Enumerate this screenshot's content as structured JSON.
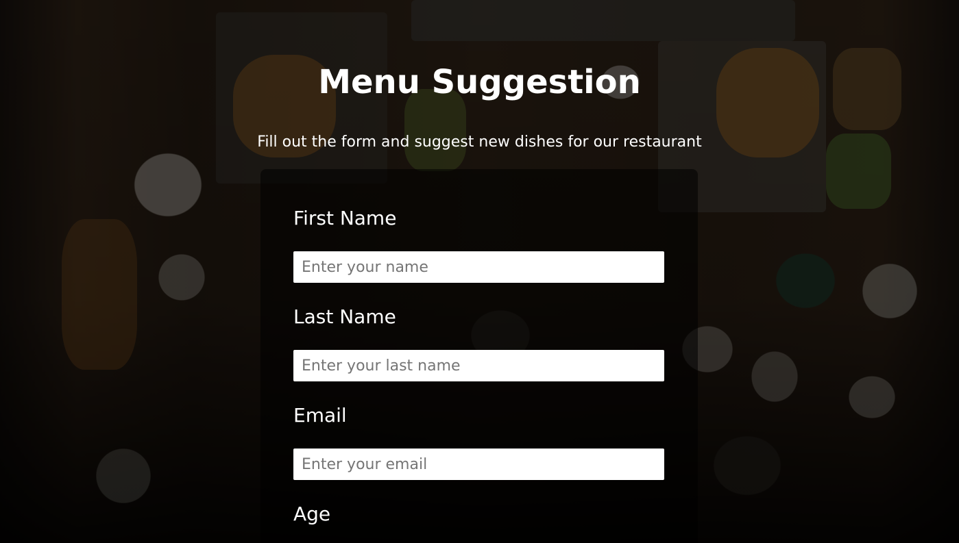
{
  "header": {
    "title": "Menu Suggestion",
    "subtitle": "Fill out the form and suggest new dishes for our restaurant"
  },
  "form": {
    "first_name": {
      "label": "First Name",
      "placeholder": "Enter your name"
    },
    "last_name": {
      "label": "Last Name",
      "placeholder": "Enter your last name"
    },
    "email": {
      "label": "Email",
      "placeholder": "Enter your email"
    },
    "age": {
      "label": "Age"
    }
  },
  "colors": {
    "text": "#ffffff",
    "overlay": "rgba(0,0,0,0.55)",
    "input_background": "#ffffff",
    "placeholder": "#757575"
  }
}
